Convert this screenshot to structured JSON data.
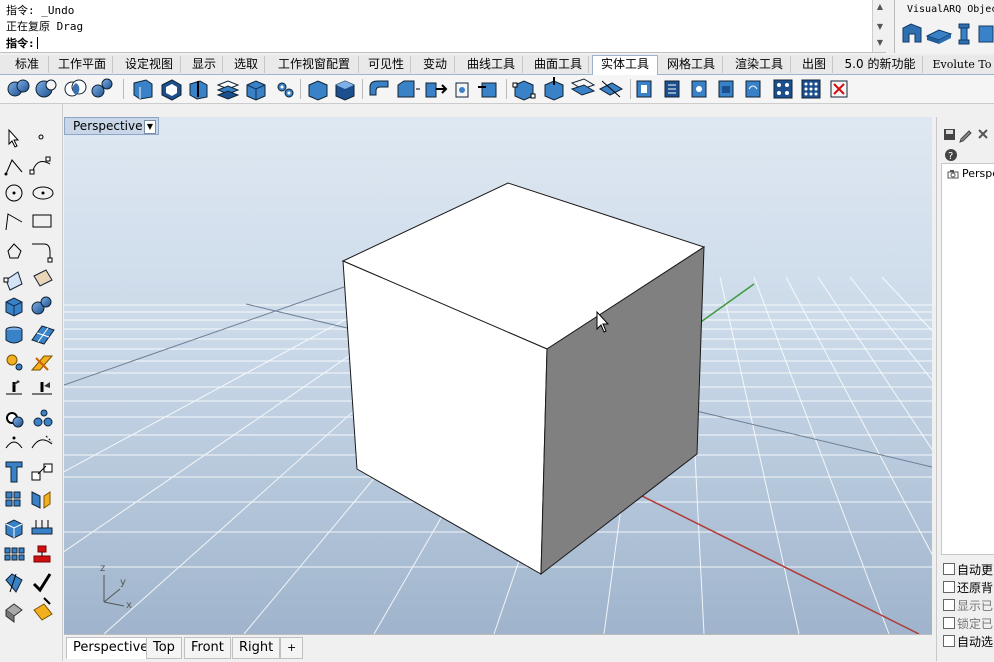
{
  "command_area": {
    "line1": "指令: _Undo",
    "line2": "正在复原 Drag",
    "prompt": "指令:"
  },
  "visualarq_panel": {
    "title": "VisualARQ Objec"
  },
  "toolbar_tabs": [
    {
      "label": "标准"
    },
    {
      "label": "工作平面"
    },
    {
      "label": "设定视图"
    },
    {
      "label": "显示"
    },
    {
      "label": "选取"
    },
    {
      "label": "工作视窗配置"
    },
    {
      "label": "可见性"
    },
    {
      "label": "变动"
    },
    {
      "label": "曲线工具"
    },
    {
      "label": "曲面工具"
    },
    {
      "label": "实体工具"
    },
    {
      "label": "网格工具"
    },
    {
      "label": "渲染工具"
    },
    {
      "label": "出图"
    },
    {
      "label": "5.0 的新功能"
    },
    {
      "label": "Evolute To"
    }
  ],
  "active_tab": "实体工具",
  "viewport": {
    "title": "Perspective",
    "axis_labels": {
      "z": "z",
      "y": "y",
      "x": "x"
    }
  },
  "viewport_tabs": [
    {
      "label": "Perspective"
    },
    {
      "label": "Top"
    },
    {
      "label": "Front"
    },
    {
      "label": "Right"
    },
    {
      "label": "+"
    }
  ],
  "right_panel": {
    "item": "Perspe",
    "options": [
      {
        "label": "自动更"
      },
      {
        "label": "还原背"
      },
      {
        "label": "显示已"
      },
      {
        "label": "锁定已"
      },
      {
        "label": "自动选"
      }
    ]
  },
  "colors": {
    "viewport_top": "#dce5f0",
    "viewport_bottom": "#9fb4cc",
    "grid": "#ffffff",
    "x_axis": "#b03a3a",
    "y_axis": "#3f9a3f",
    "cube_top": "#ffffff",
    "cube_front": "#ffffff",
    "cube_side": "#808080"
  }
}
